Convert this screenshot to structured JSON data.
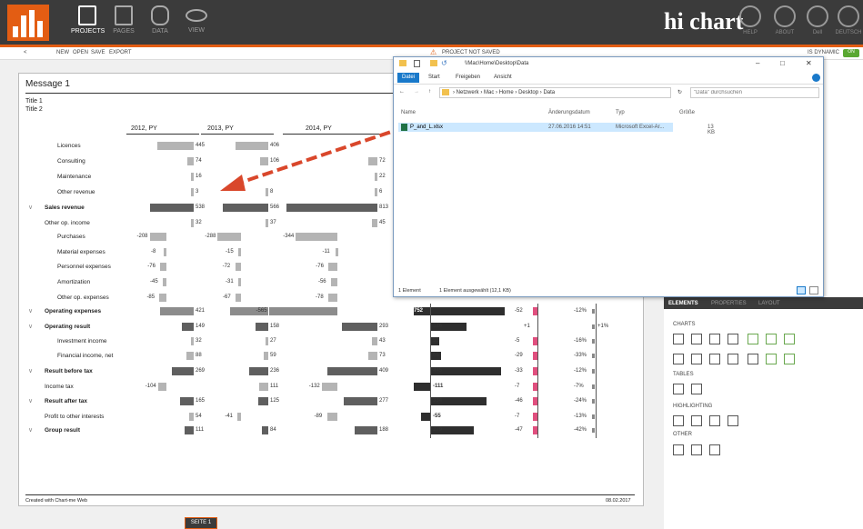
{
  "toolbar": {
    "projects": "PROJECTS",
    "pages": "PAGES",
    "data": "DATA",
    "view": "VIEW",
    "brand": "hi chart",
    "help": "HELP",
    "about": "ABOUT",
    "dell": "Dell",
    "deutsch": "DEUTSCH"
  },
  "menu": {
    "back": "<",
    "new": "NEW",
    "open": "OPEN",
    "save": "SAVE",
    "export": "EXPORT",
    "status": "PROJECT NOT SAVED",
    "dynamic": "IS DYNAMIC",
    "on": "ON"
  },
  "report": {
    "message": "Message 1",
    "title1": "Title 1",
    "title2": "Title 2",
    "footer_left": "Created with Chart-me Web",
    "footer_right": "08.02.2017",
    "columns": [
      "2012, PY",
      "2013, PY",
      "2014, PY"
    ],
    "rows": [
      {
        "label": "Licences",
        "v": [
          "445",
          "406",
          ""
        ]
      },
      {
        "label": "Consulting",
        "v": [
          "74",
          "106",
          "72"
        ]
      },
      {
        "label": "Maintenance",
        "v": [
          "16",
          "",
          "22"
        ]
      },
      {
        "label": "Other revenue",
        "v": [
          "3",
          "8",
          "6"
        ]
      },
      {
        "label": "Sales revenue",
        "v": [
          "538",
          "566",
          "813"
        ]
      },
      {
        "label": "Other op. income",
        "v": [
          "32",
          "37",
          "45"
        ]
      },
      {
        "label": "Purchases",
        "v": [
          "-208",
          "-288",
          "-344"
        ]
      },
      {
        "label": "Material expenses",
        "v": [
          "-8",
          "-15",
          "-11"
        ]
      },
      {
        "label": "Personnel expenses",
        "v": [
          "-76",
          "-72",
          "-76"
        ]
      },
      {
        "label": "Amortization",
        "v": [
          "-45",
          "-31",
          "-56"
        ]
      },
      {
        "label": "Other op. expenses",
        "v": [
          "-85",
          "-67",
          "-78"
        ]
      },
      {
        "label": "Operating expenses",
        "v": [
          "421",
          "473",
          "-565"
        ]
      },
      {
        "label": "Operating result",
        "v": [
          "149",
          "158",
          "293"
        ]
      },
      {
        "label": "Investment income",
        "v": [
          "32",
          "27",
          "43"
        ]
      },
      {
        "label": "Financial income, net",
        "v": [
          "88",
          "59",
          "73"
        ]
      },
      {
        "label": "Result before tax",
        "v": [
          "269",
          "236",
          "409"
        ]
      },
      {
        "label": "Income tax",
        "v": [
          "-104",
          "111",
          "-132"
        ]
      },
      {
        "label": "Result after tax",
        "v": [
          "165",
          "125",
          "277"
        ]
      },
      {
        "label": "Profit to other interests",
        "v": [
          "54",
          "-41",
          "-89"
        ]
      },
      {
        "label": "Group result",
        "v": [
          "111",
          "84",
          "188"
        ]
      }
    ],
    "col4": [
      "-752",
      "326",
      "53",
      "66",
      "445",
      "-111",
      "334",
      "-55",
      "279"
    ],
    "col5": [
      "-52",
      "+1",
      "-5",
      "-29",
      "-33",
      "-7",
      "-46",
      "-7",
      "-47"
    ],
    "col6": [
      "-12%",
      "+1%",
      "-16%",
      "-33%",
      "-12%",
      "-7%",
      "-24%",
      "-13%",
      "-42%"
    ]
  },
  "explorer": {
    "path": "\\\\Mac\\Home\\Desktop\\Data",
    "tabs": [
      "Datei",
      "Start",
      "Freigeben",
      "Ansicht"
    ],
    "crumbs": [
      "Netzwerk",
      "Mac",
      "Home",
      "Desktop",
      "Data"
    ],
    "search_placeholder": "\"Data\" durchsuchen",
    "col_name": "Name",
    "col_date": "Änderungsdatum",
    "col_type": "Typ",
    "col_size": "Größe",
    "file_name": "P_and_L.xlsx",
    "file_date": "27.06.2016 14:51",
    "file_type": "Microsoft Excel-Ar...",
    "file_size": "13 KB",
    "status_count": "1 Element",
    "status_sel": "1 Element ausgewählt (12,1 KB)"
  },
  "elements": {
    "tabs": [
      "ELEMENTS",
      "PROPERTIES",
      "LAYOUT"
    ],
    "charts": "CHARTS",
    "tables": "TABLES",
    "highlighting": "HIGHLIGHTING",
    "other": "OTHER"
  },
  "page_indicator": "SEITE 1",
  "colors": {
    "accent": "#e35d13",
    "dark": "#3b3b3b",
    "drag_arrow": "#d9472b",
    "negative": "#e04f7e"
  }
}
